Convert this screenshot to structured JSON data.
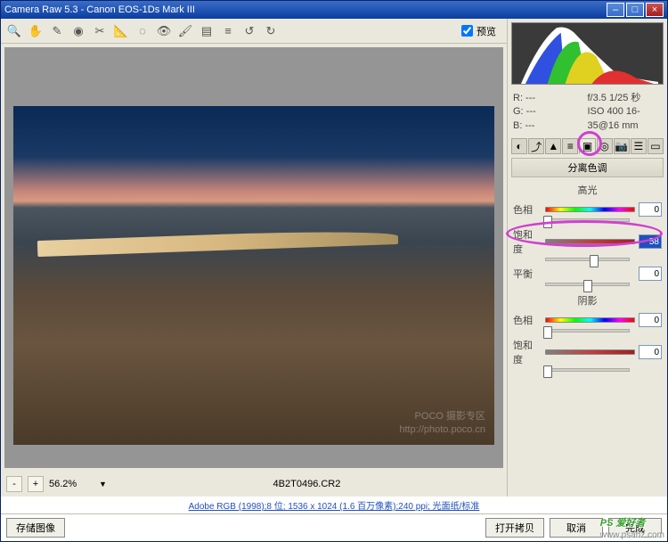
{
  "titlebar": {
    "text": "Camera Raw 5.3  -  Canon EOS-1Ds Mark III"
  },
  "toolbar": {
    "icons": [
      "zoom-icon",
      "hand-icon",
      "eyedropper-icon",
      "color-sampler-icon",
      "crop-icon",
      "straighten-icon",
      "spot-removal-icon",
      "redeye-icon",
      "adjustment-brush-icon",
      "graduated-filter-icon",
      "open-preferences-icon",
      "rotate-ccw-icon",
      "rotate-cw-icon"
    ],
    "preview_label": "预览"
  },
  "info": {
    "r": "R: ---",
    "g": "G: ---",
    "b": "B: ---",
    "aperture": "f/3.5  1/25 秒",
    "iso": "ISO 400  16-35@16 mm"
  },
  "panel": {
    "title": "分离色调"
  },
  "highlights": {
    "title": "高光",
    "hue_label": "色相",
    "hue_value": "0",
    "sat_label": "饱和度",
    "sat_value": "58",
    "bal_label": "平衡",
    "bal_value": "0"
  },
  "shadows": {
    "title": "阴影",
    "hue_label": "色相",
    "hue_value": "0",
    "sat_label": "饱和度",
    "sat_value": "0"
  },
  "zoom": {
    "minus": "-",
    "plus": "+",
    "level": "56.2%"
  },
  "filename": "4B2T0496.CR2",
  "profile_info": "Adobe RGB (1998);8 位; 1536 x 1024 (1.6 百万像素);240 ppi; 光面纸/标准",
  "footer": {
    "save": "存储图像",
    "open": "打开拷贝",
    "cancel": "取消",
    "done": "完成"
  },
  "watermark": {
    "line1": "POCO 摄影专区",
    "line2": "http://photo.poco.cn"
  },
  "sitemark": {
    "big": "PS 爱好者",
    "small": "www.psahz.com"
  }
}
